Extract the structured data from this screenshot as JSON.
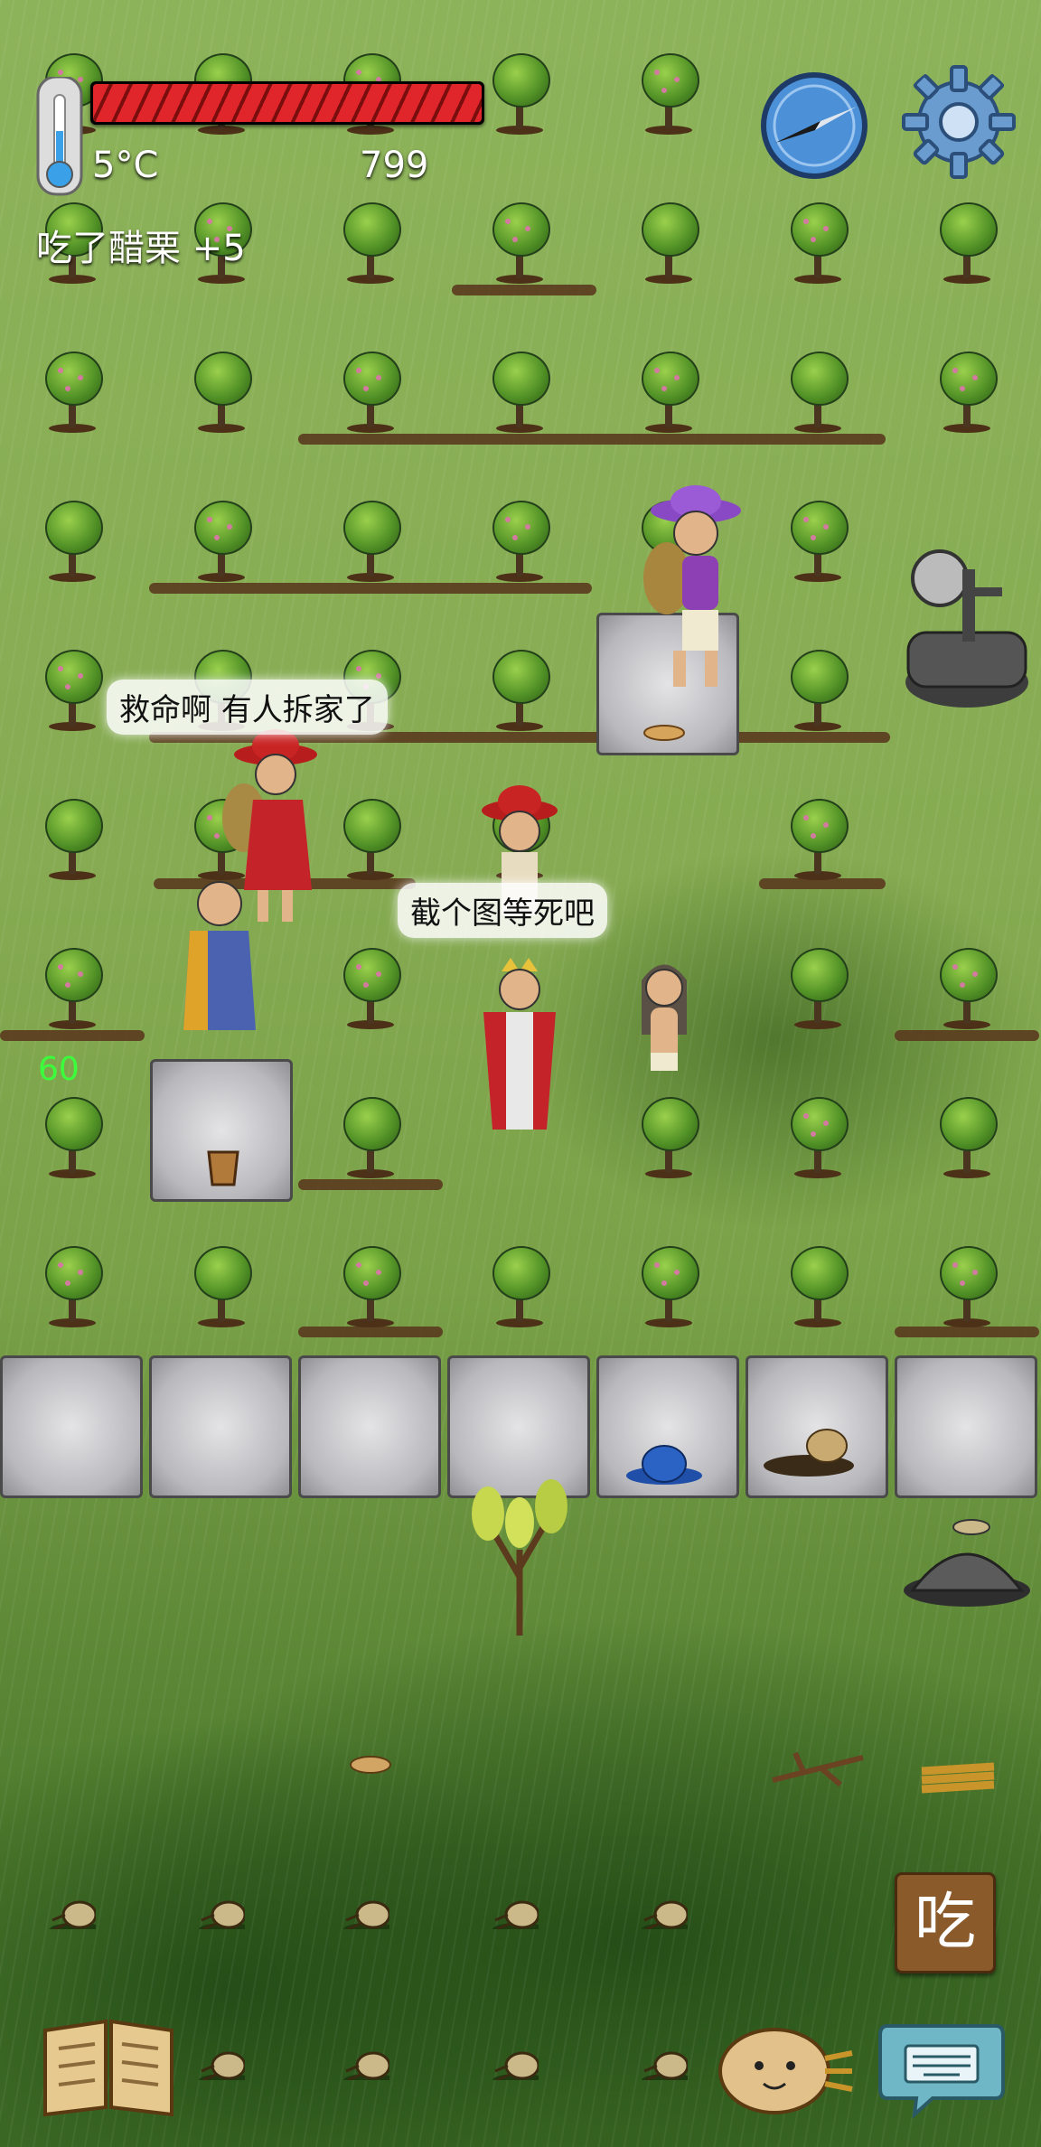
{
  "hud": {
    "temperature": "5°C",
    "score": "799",
    "last_food_message": "吃了醋栗 +5",
    "hunger_fraction": 1.0
  },
  "chat": {
    "bubble_1": "救命啊 有人拆家了",
    "bubble_2": "截个图等死吧"
  },
  "debug": {
    "fps": "60"
  },
  "actions": {
    "eat_label": "吃"
  },
  "icons": {
    "thermometer": "thermometer-icon",
    "compass": "compass-icon",
    "settings": "gear-icon",
    "recipe_book": "book-icon",
    "emote": "emote-face-icon",
    "keyboard": "keyboard-icon"
  },
  "colors": {
    "hunger_bar": "#e0262a",
    "fps_text": "#3cff3c",
    "eat_button": "#8b5a2b"
  }
}
